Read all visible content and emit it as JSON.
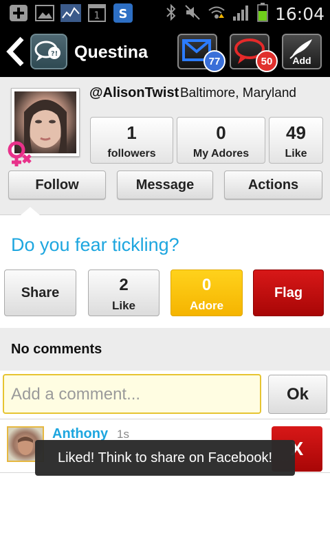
{
  "status_bar": {
    "time": "16:04",
    "left_icons": [
      "add-icon",
      "gallery-icon",
      "chart-icon",
      "calendar-icon",
      "shazam-icon"
    ],
    "right_icons": [
      "bluetooth-icon",
      "mute-icon",
      "wifi-icon",
      "signal-icon",
      "battery-icon"
    ]
  },
  "action_bar": {
    "title": "Questina",
    "messages_count": "77",
    "notifications_count": "50",
    "add_label": "Add"
  },
  "profile": {
    "username": "@AlisonTwist",
    "location": "Baltimore, Maryland",
    "stats": [
      {
        "value": "1",
        "label": "followers"
      },
      {
        "value": "0",
        "label": "My Adores"
      },
      {
        "value": "49",
        "label": "Like"
      }
    ],
    "buttons": {
      "follow": "Follow",
      "message": "Message",
      "actions": "Actions"
    }
  },
  "question": {
    "text": "Do you fear tickling?",
    "share_label": "Share",
    "like_count": "2",
    "like_label": "Like",
    "adore_count": "0",
    "adore_label": "Adore",
    "flag_label": "Flag"
  },
  "comments": {
    "header": "No comments",
    "input_placeholder": "Add a comment...",
    "ok_label": "Ok",
    "items": [
      {
        "author": "Anthony",
        "time": "1s",
        "delete_label": "X"
      }
    ]
  },
  "toast": {
    "message": "Liked! Think to share on Facebook!"
  },
  "colors": {
    "accent_blue": "#1da6df",
    "adore_yellow": "#f5b400",
    "flag_red": "#c40f0f",
    "gender_pink": "#e8318a"
  }
}
